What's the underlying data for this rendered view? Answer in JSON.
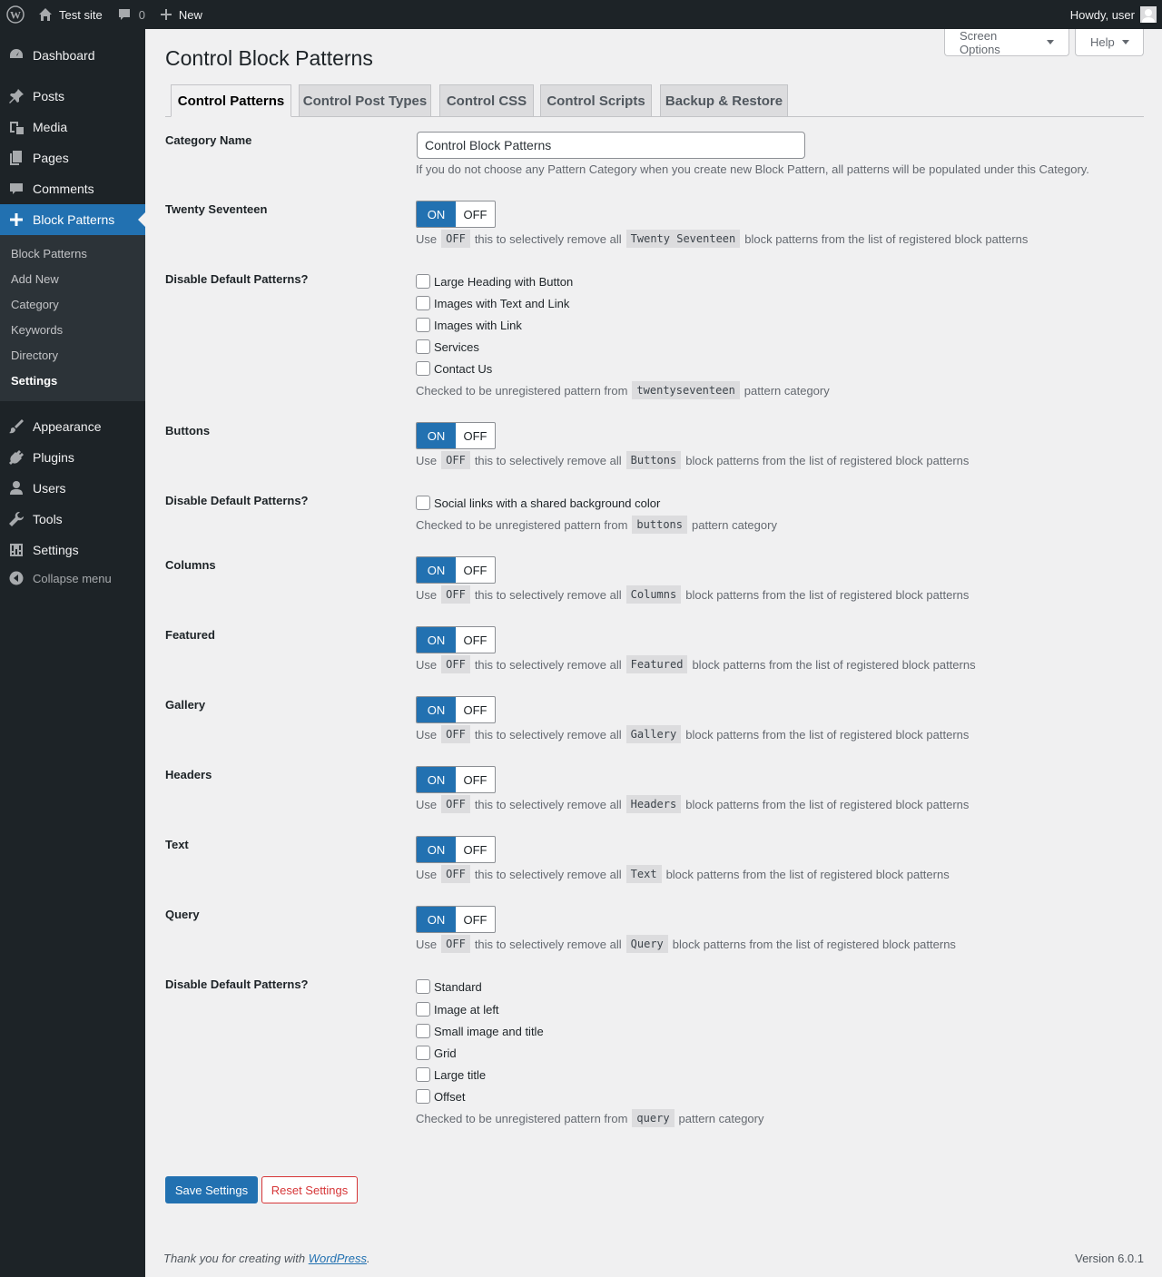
{
  "adminbar": {
    "site_name": "Test site",
    "comments_count": "0",
    "new_label": "New",
    "howdy": "Howdy, user"
  },
  "sidebar": {
    "menu": [
      {
        "label": "Dashboard",
        "icon": "dashboard-icon"
      },
      {
        "label": "Posts",
        "icon": "pin-icon"
      },
      {
        "label": "Media",
        "icon": "media-icon"
      },
      {
        "label": "Pages",
        "icon": "pages-icon"
      },
      {
        "label": "Comments",
        "icon": "comment-icon"
      },
      {
        "label": "Block Patterns",
        "icon": "plus-icon"
      },
      {
        "label": "Appearance",
        "icon": "brush-icon"
      },
      {
        "label": "Plugins",
        "icon": "plug-icon"
      },
      {
        "label": "Users",
        "icon": "user-icon"
      },
      {
        "label": "Tools",
        "icon": "wrench-icon"
      },
      {
        "label": "Settings",
        "icon": "settings-icon"
      }
    ],
    "submenu": [
      "Block Patterns",
      "Add New",
      "Category",
      "Keywords",
      "Directory",
      "Settings"
    ],
    "collapse_label": "Collapse menu"
  },
  "header": {
    "screen_options": "Screen Options",
    "help": "Help",
    "title": "Control Block Patterns"
  },
  "tabs": [
    "Control Patterns",
    "Control Post Types",
    "Control CSS",
    "Control Scripts",
    "Backup & Restore"
  ],
  "form": {
    "category_label": "Category Name",
    "category_value": "Control Block Patterns",
    "category_desc": "If you do not choose any Pattern Category when you create new Block Pattern, all patterns will be populated under this Category.",
    "on": "ON",
    "off": "OFF",
    "use": "Use",
    "selectively": "this to selectively remove all",
    "from_list": "block patterns from the list of registered block patterns",
    "checked_prefix": "Checked to be unregistered pattern from",
    "pattern_category": "pattern category",
    "disable_label": "Disable Default Patterns?",
    "sections": {
      "twentyseventeen": {
        "label": "Twenty Seventeen",
        "code": "Twenty Seventeen",
        "state": "ON"
      },
      "buttons": {
        "label": "Buttons",
        "code": "Buttons",
        "state": "ON"
      },
      "columns": {
        "label": "Columns",
        "code": "Columns",
        "state": "ON"
      },
      "featured": {
        "label": "Featured",
        "code": "Featured",
        "state": "ON"
      },
      "gallery": {
        "label": "Gallery",
        "code": "Gallery",
        "state": "ON"
      },
      "headers": {
        "label": "Headers",
        "code": "Headers",
        "state": "ON"
      },
      "text": {
        "label": "Text",
        "code": "Text",
        "state": "ON"
      },
      "query": {
        "label": "Query",
        "code": "Query",
        "state": "ON"
      }
    },
    "checklists": {
      "twentyseventeen": {
        "items": [
          "Large Heading with Button",
          "Images with Text and Link",
          "Images with Link",
          "Services",
          "Contact Us"
        ],
        "category": "twentyseventeen"
      },
      "buttons": {
        "items": [
          "Social links with a shared background color"
        ],
        "category": "buttons"
      },
      "query": {
        "items": [
          "Standard",
          "Image at left",
          "Small image and title",
          "Grid",
          "Large title",
          "Offset"
        ],
        "category": "query"
      }
    },
    "save": "Save Settings",
    "reset": "Reset Settings"
  },
  "footer": {
    "thanks": "Thank you for creating with",
    "wp_link": "WordPress",
    "version": "Version 6.0.1"
  }
}
